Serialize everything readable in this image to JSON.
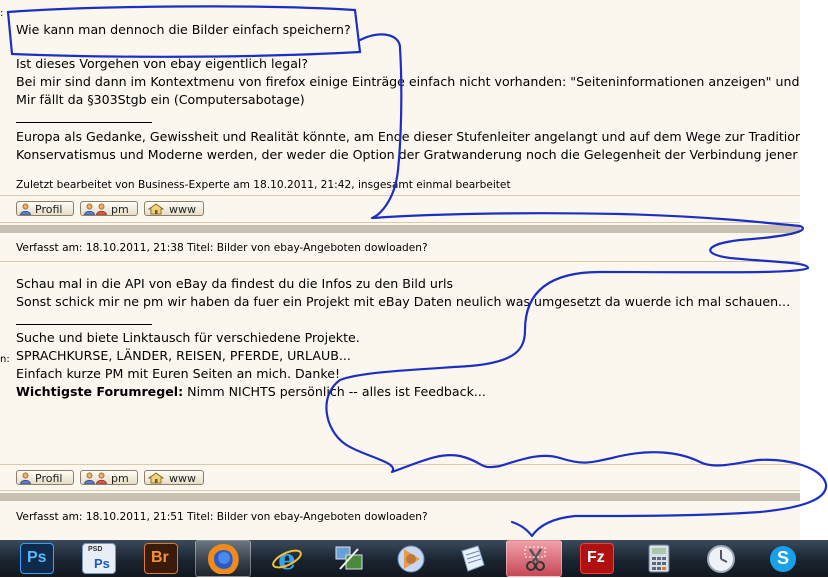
{
  "post1": {
    "quote": "Wie kann man dennoch die Bilder einfach speichern?",
    "lines": [
      "Ist dieses Vorgehen von ebay eigentlich legal?",
      "Bei mir sind dann im Kontextmenu von firefox einige Einträge einfach nicht vorhanden: \"Seiteninformationen anzeigen\" und \"",
      "Mir fällt da §303Stgb ein (Computersabotage)"
    ],
    "signature": [
      "Europa als Gedanke, Gewissheit und Realität könnte, am Ende dieser Stufenleiter angelangt und auf dem Wege zur Tradition",
      "Konservatismus und Moderne werden, der weder die Option der Gratwanderung noch die Gelegenheit der Verbindung jener"
    ],
    "edited": "Zuletzt bearbeitet von Business-Experte am 18.10.2011, 21:42, insgesamt einmal bearbeitet"
  },
  "buttons": {
    "profil": "Profil",
    "pm": "pm",
    "www": "www"
  },
  "post2": {
    "header": "Verfasst am: 18.10.2011, 21:38    Titel: Bilder von ebay-Angeboten dowloaden?",
    "lines": [
      "Schau mal in die API von eBay da findest du die Infos zu den Bild urls",
      "Sonst schick mir ne pm wir haben da fuer ein Projekt mit eBay Daten neulich was umgesetzt da wuerde ich mal schauen..."
    ],
    "signature": [
      "Suche und biete Linktausch für verschiedene Projekte.",
      "SPRACHKURSE, LÄNDER, REISEN, PFERDE, URLAUB...",
      "Einfach kurze PM mit Euren Seiten an mich. Danke!"
    ],
    "rule_label": "Wichtigste Forumregel:",
    "rule_text": " Nimm NICHTS persönlich -- alles ist Feedback..."
  },
  "post3": {
    "header": "Verfasst am: 18.10.2011, 21:51    Titel: Bilder von ebay-Angeboten dowloaden?"
  },
  "left_cut": {
    "colon_top": ":",
    "n_mid": "n:"
  },
  "taskbar": {
    "items": [
      {
        "icon": "photoshop-icon",
        "label": "Ps"
      },
      {
        "icon": "photoshop-document-icon",
        "label": "Ps",
        "sub": "PSD"
      },
      {
        "icon": "bridge-icon",
        "label": "Br"
      },
      {
        "icon": "firefox-icon",
        "label": ""
      },
      {
        "icon": "internet-explorer-icon",
        "label": ""
      },
      {
        "icon": "network-tool-icon",
        "label": ""
      },
      {
        "icon": "media-player-icon",
        "label": ""
      },
      {
        "icon": "notepad-icon",
        "label": ""
      },
      {
        "icon": "snipping-tool-icon",
        "label": ""
      },
      {
        "icon": "filezilla-icon",
        "label": "Fz"
      },
      {
        "icon": "calculator-icon",
        "label": ""
      },
      {
        "icon": "clock-icon",
        "label": ""
      },
      {
        "icon": "skype-icon",
        "label": "S"
      }
    ]
  },
  "colors": {
    "page_bg": "#fcf7ee",
    "ink": "#1c2fc4",
    "button_border": "#8e7f6a",
    "taskbar": "#1a2430"
  }
}
